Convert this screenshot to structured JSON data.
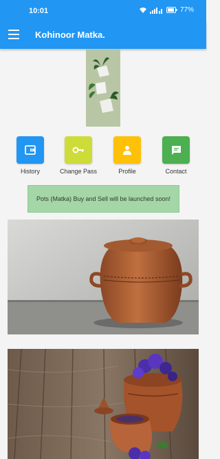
{
  "status_bar": {
    "time": "10:01",
    "battery": "77%",
    "icons": [
      "wifi-icon",
      "signal-icon",
      "battery-icon"
    ]
  },
  "app_bar": {
    "title": "Kohinoor Matka.",
    "color": "#2196f3"
  },
  "actions": [
    {
      "label": "History",
      "icon": "wallet-icon",
      "color": "#2196f3"
    },
    {
      "label": "Change Pass",
      "icon": "key-icon",
      "color": "#cddc39"
    },
    {
      "label": "Profile",
      "icon": "person-icon",
      "color": "#ffc107"
    },
    {
      "label": "Contact",
      "icon": "chat-icon",
      "color": "#4caf50"
    }
  ],
  "notice": {
    "text": "Pots (Matka) Buy and Sell will be launched soon!",
    "color": "#a5d6a7"
  },
  "images": [
    {
      "name": "clay-pot-photo"
    },
    {
      "name": "clay-pots-flowers-photo"
    }
  ]
}
